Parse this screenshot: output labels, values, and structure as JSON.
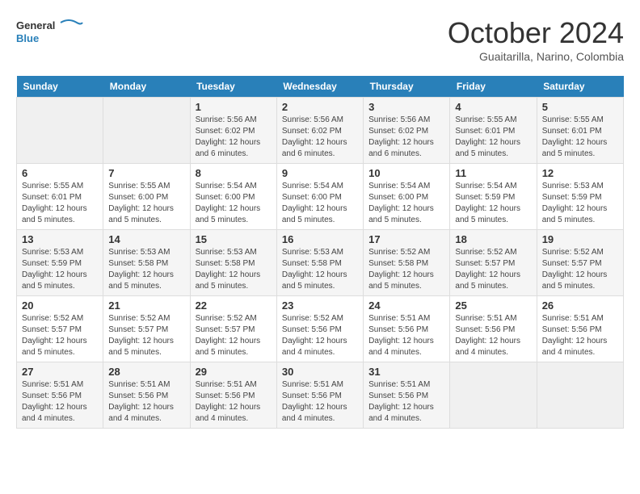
{
  "header": {
    "logo_general": "General",
    "logo_blue": "Blue",
    "month_title": "October 2024",
    "location": "Guaitarilla, Narino, Colombia"
  },
  "weekdays": [
    "Sunday",
    "Monday",
    "Tuesday",
    "Wednesday",
    "Thursday",
    "Friday",
    "Saturday"
  ],
  "weeks": [
    [
      {
        "day": "",
        "sunrise": "",
        "sunset": "",
        "daylight": "",
        "empty": true
      },
      {
        "day": "",
        "sunrise": "",
        "sunset": "",
        "daylight": "",
        "empty": true
      },
      {
        "day": "1",
        "sunrise": "Sunrise: 5:56 AM",
        "sunset": "Sunset: 6:02 PM",
        "daylight": "Daylight: 12 hours and 6 minutes."
      },
      {
        "day": "2",
        "sunrise": "Sunrise: 5:56 AM",
        "sunset": "Sunset: 6:02 PM",
        "daylight": "Daylight: 12 hours and 6 minutes."
      },
      {
        "day": "3",
        "sunrise": "Sunrise: 5:56 AM",
        "sunset": "Sunset: 6:02 PM",
        "daylight": "Daylight: 12 hours and 6 minutes."
      },
      {
        "day": "4",
        "sunrise": "Sunrise: 5:55 AM",
        "sunset": "Sunset: 6:01 PM",
        "daylight": "Daylight: 12 hours and 5 minutes."
      },
      {
        "day": "5",
        "sunrise": "Sunrise: 5:55 AM",
        "sunset": "Sunset: 6:01 PM",
        "daylight": "Daylight: 12 hours and 5 minutes."
      }
    ],
    [
      {
        "day": "6",
        "sunrise": "Sunrise: 5:55 AM",
        "sunset": "Sunset: 6:01 PM",
        "daylight": "Daylight: 12 hours and 5 minutes."
      },
      {
        "day": "7",
        "sunrise": "Sunrise: 5:55 AM",
        "sunset": "Sunset: 6:00 PM",
        "daylight": "Daylight: 12 hours and 5 minutes."
      },
      {
        "day": "8",
        "sunrise": "Sunrise: 5:54 AM",
        "sunset": "Sunset: 6:00 PM",
        "daylight": "Daylight: 12 hours and 5 minutes."
      },
      {
        "day": "9",
        "sunrise": "Sunrise: 5:54 AM",
        "sunset": "Sunset: 6:00 PM",
        "daylight": "Daylight: 12 hours and 5 minutes."
      },
      {
        "day": "10",
        "sunrise": "Sunrise: 5:54 AM",
        "sunset": "Sunset: 6:00 PM",
        "daylight": "Daylight: 12 hours and 5 minutes."
      },
      {
        "day": "11",
        "sunrise": "Sunrise: 5:54 AM",
        "sunset": "Sunset: 5:59 PM",
        "daylight": "Daylight: 12 hours and 5 minutes."
      },
      {
        "day": "12",
        "sunrise": "Sunrise: 5:53 AM",
        "sunset": "Sunset: 5:59 PM",
        "daylight": "Daylight: 12 hours and 5 minutes."
      }
    ],
    [
      {
        "day": "13",
        "sunrise": "Sunrise: 5:53 AM",
        "sunset": "Sunset: 5:59 PM",
        "daylight": "Daylight: 12 hours and 5 minutes."
      },
      {
        "day": "14",
        "sunrise": "Sunrise: 5:53 AM",
        "sunset": "Sunset: 5:58 PM",
        "daylight": "Daylight: 12 hours and 5 minutes."
      },
      {
        "day": "15",
        "sunrise": "Sunrise: 5:53 AM",
        "sunset": "Sunset: 5:58 PM",
        "daylight": "Daylight: 12 hours and 5 minutes."
      },
      {
        "day": "16",
        "sunrise": "Sunrise: 5:53 AM",
        "sunset": "Sunset: 5:58 PM",
        "daylight": "Daylight: 12 hours and 5 minutes."
      },
      {
        "day": "17",
        "sunrise": "Sunrise: 5:52 AM",
        "sunset": "Sunset: 5:58 PM",
        "daylight": "Daylight: 12 hours and 5 minutes."
      },
      {
        "day": "18",
        "sunrise": "Sunrise: 5:52 AM",
        "sunset": "Sunset: 5:57 PM",
        "daylight": "Daylight: 12 hours and 5 minutes."
      },
      {
        "day": "19",
        "sunrise": "Sunrise: 5:52 AM",
        "sunset": "Sunset: 5:57 PM",
        "daylight": "Daylight: 12 hours and 5 minutes."
      }
    ],
    [
      {
        "day": "20",
        "sunrise": "Sunrise: 5:52 AM",
        "sunset": "Sunset: 5:57 PM",
        "daylight": "Daylight: 12 hours and 5 minutes."
      },
      {
        "day": "21",
        "sunrise": "Sunrise: 5:52 AM",
        "sunset": "Sunset: 5:57 PM",
        "daylight": "Daylight: 12 hours and 5 minutes."
      },
      {
        "day": "22",
        "sunrise": "Sunrise: 5:52 AM",
        "sunset": "Sunset: 5:57 PM",
        "daylight": "Daylight: 12 hours and 5 minutes."
      },
      {
        "day": "23",
        "sunrise": "Sunrise: 5:52 AM",
        "sunset": "Sunset: 5:56 PM",
        "daylight": "Daylight: 12 hours and 4 minutes."
      },
      {
        "day": "24",
        "sunrise": "Sunrise: 5:51 AM",
        "sunset": "Sunset: 5:56 PM",
        "daylight": "Daylight: 12 hours and 4 minutes."
      },
      {
        "day": "25",
        "sunrise": "Sunrise: 5:51 AM",
        "sunset": "Sunset: 5:56 PM",
        "daylight": "Daylight: 12 hours and 4 minutes."
      },
      {
        "day": "26",
        "sunrise": "Sunrise: 5:51 AM",
        "sunset": "Sunset: 5:56 PM",
        "daylight": "Daylight: 12 hours and 4 minutes."
      }
    ],
    [
      {
        "day": "27",
        "sunrise": "Sunrise: 5:51 AM",
        "sunset": "Sunset: 5:56 PM",
        "daylight": "Daylight: 12 hours and 4 minutes."
      },
      {
        "day": "28",
        "sunrise": "Sunrise: 5:51 AM",
        "sunset": "Sunset: 5:56 PM",
        "daylight": "Daylight: 12 hours and 4 minutes."
      },
      {
        "day": "29",
        "sunrise": "Sunrise: 5:51 AM",
        "sunset": "Sunset: 5:56 PM",
        "daylight": "Daylight: 12 hours and 4 minutes."
      },
      {
        "day": "30",
        "sunrise": "Sunrise: 5:51 AM",
        "sunset": "Sunset: 5:56 PM",
        "daylight": "Daylight: 12 hours and 4 minutes."
      },
      {
        "day": "31",
        "sunrise": "Sunrise: 5:51 AM",
        "sunset": "Sunset: 5:56 PM",
        "daylight": "Daylight: 12 hours and 4 minutes."
      },
      {
        "day": "",
        "sunrise": "",
        "sunset": "",
        "daylight": "",
        "empty": true
      },
      {
        "day": "",
        "sunrise": "",
        "sunset": "",
        "daylight": "",
        "empty": true
      }
    ]
  ]
}
